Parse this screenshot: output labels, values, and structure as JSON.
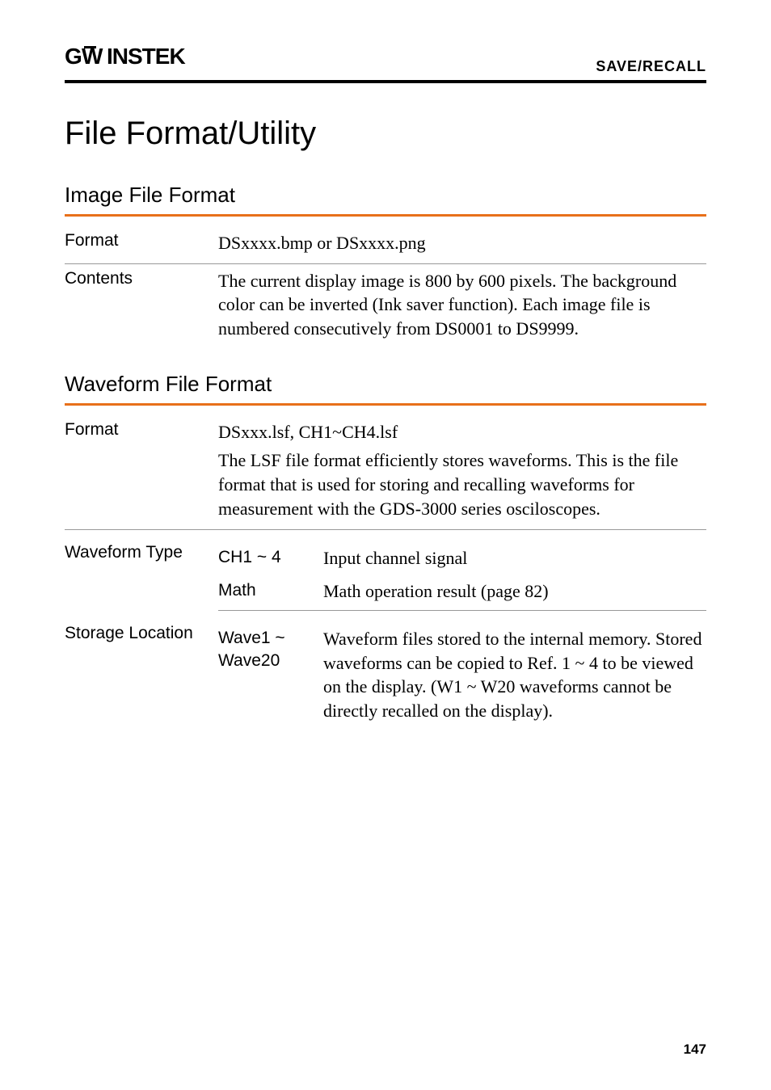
{
  "header": {
    "logo": "GWINSTEK",
    "section": "SAVE/RECALL"
  },
  "title": "File Format/Utility",
  "image_file_format": {
    "heading": "Image File Format",
    "rows": {
      "format_label": "Format",
      "format_value": "DSxxxx.bmp or DSxxxx.png",
      "contents_label": "Contents",
      "contents_value": "The current display image is 800 by 600 pixels. The background color can be inverted (Ink saver function). Each image file is numbered consecutively from DS0001 to DS9999."
    }
  },
  "waveform_file_format": {
    "heading": "Waveform File Format",
    "rows": {
      "format_label": "Format",
      "format_value": "DSxxx.lsf, CH1~CH4.lsf",
      "format_desc": "The LSF file format efficiently stores waveforms. This is the file format that is used for storing and recalling waveforms for measurement with the GDS-3000 series osciloscopes.",
      "waveform_type_label": "Waveform Type",
      "waveform_type_rows": [
        {
          "name": "CH1 ~ 4",
          "desc": "Input channel signal"
        },
        {
          "name": "Math",
          "desc": "Math operation result (page 82)"
        }
      ],
      "storage_location_label": "Storage Location",
      "storage_location_rows": [
        {
          "name": "Wave1 ~ Wave20",
          "desc": "Waveform files stored to the internal memory. Stored waveforms can be copied to Ref. 1 ~ 4 to be viewed on the display. (W1 ~ W20 waveforms cannot be directly recalled on the display)."
        }
      ]
    }
  },
  "page_number": "147"
}
